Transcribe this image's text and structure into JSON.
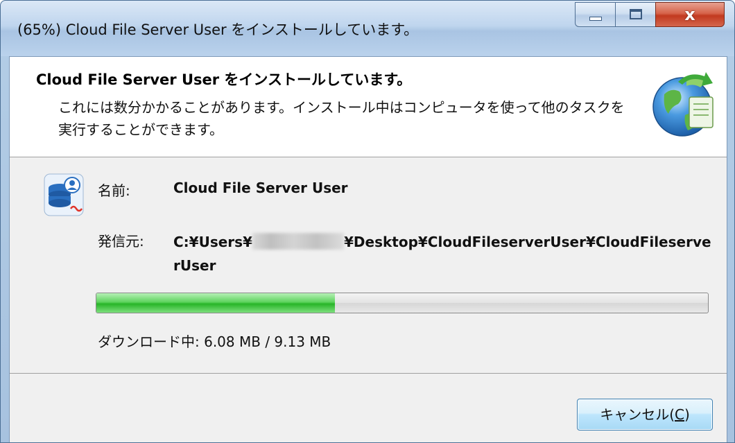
{
  "window": {
    "title": "(65%) Cloud File Server User をインストールしています。",
    "minimize_icon": "minimize-icon",
    "maximize_icon": "maximize-icon",
    "close_icon": "close-icon",
    "close_glyph": "x"
  },
  "header": {
    "title": "Cloud File Server User をインストールしています。",
    "description": "これには数分かかることがあります。インストール中はコンピュータを使って他のタスクを実行することができます。",
    "icon": "globe-install-icon"
  },
  "details": {
    "app_icon": "database-user-icon",
    "name_label": "名前:",
    "name_value": "Cloud File Server User",
    "source_label": "発信元:",
    "source_prefix": "C:¥Users¥",
    "source_suffix": "¥Desktop¥CloudFileserverUser¥CloudFileserverUser"
  },
  "progress": {
    "fraction": 0.39,
    "status": "ダウンロード中: 6.08 MB / 9.13 MB",
    "fill_color": "#3cc33c"
  },
  "footer": {
    "cancel_label": "キャンセル(",
    "cancel_mnemonic": "C",
    "cancel_suffix": ")"
  }
}
